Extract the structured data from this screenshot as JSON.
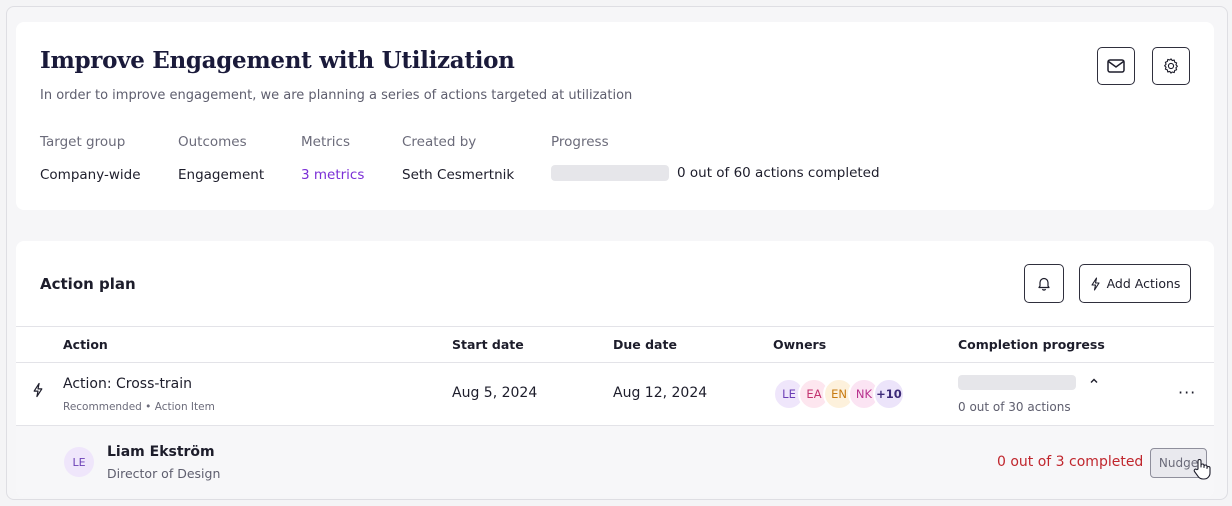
{
  "plan": {
    "title": "Improve Engagement with Utilization",
    "description": "In order to improve engagement, we are planning a series of actions targeted at utilization",
    "icons": {
      "mail": "mail-icon",
      "settings": "gear-icon"
    },
    "meta": {
      "target_group": {
        "label": "Target group",
        "value": "Company-wide"
      },
      "outcomes": {
        "label": "Outcomes",
        "value": "Engagement"
      },
      "metrics": {
        "label": "Metrics",
        "value": "3 metrics"
      },
      "created_by": {
        "label": "Created by",
        "value": "Seth Cesmertnik"
      },
      "progress": {
        "label": "Progress",
        "text": "0 out of 60 actions completed",
        "fraction": 0
      }
    }
  },
  "action_plan": {
    "title": "Action plan",
    "add_actions_label": "Add Actions",
    "icons": {
      "bell": "bell-icon",
      "bolt": "bolt-icon"
    },
    "columns": {
      "action": "Action",
      "start_date": "Start date",
      "due_date": "Due date",
      "owners": "Owners",
      "completion": "Completion progress"
    },
    "rows": [
      {
        "name": "Action: Cross-train",
        "subtitle": "Recommended • Action Item",
        "start_date": "Aug 5, 2024",
        "due_date": "Aug 12, 2024",
        "owners": [
          {
            "initials": "LE",
            "bg": "#efe6fb",
            "fg": "#6b3fb6"
          },
          {
            "initials": "EA",
            "bg": "#fde6ef",
            "fg": "#c2336f"
          },
          {
            "initials": "EN",
            "bg": "#fdf1dc",
            "fg": "#c77a10"
          },
          {
            "initials": "NK",
            "bg": "#fbe4f3",
            "fg": "#b8328e"
          }
        ],
        "owners_more": "+10",
        "progress_text": "0 out of 30 actions",
        "progress_fraction": 0,
        "owner_detail": {
          "initials": "LE",
          "name": "Liam Ekström",
          "role": "Director of Design",
          "status": "0 out of 3 completed",
          "nudge_label": "Nudge"
        }
      }
    ]
  },
  "colors": {
    "accent": "#7b2ed6",
    "danger": "#c0262d"
  }
}
